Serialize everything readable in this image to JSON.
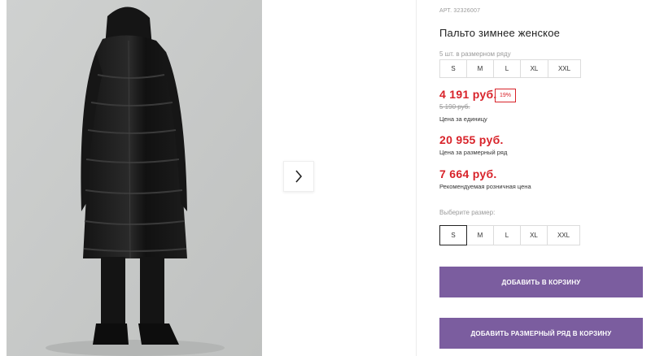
{
  "gallery": {
    "next_icon": "chevron-right-icon"
  },
  "product": {
    "sku": "АРТ. 32326007",
    "title": "Пальто зимнее женское",
    "row_note": "5 шт. в размерном ряду",
    "row_sizes": [
      "S",
      "M",
      "L",
      "XL",
      "XXL"
    ],
    "price": "4 191 руб.",
    "discount": "19%",
    "old_price": "5 190 руб.",
    "price_unit_label": "Цена за единицу",
    "row_price": "20 955 руб.",
    "row_price_label": "Цена за размерный ряд",
    "rrp": "7 664 руб.",
    "rrp_label": "Рекомендуемая розничная цена",
    "choose_size_label": "Выберите размер:",
    "size_options": [
      "S",
      "M",
      "L",
      "XL",
      "XXL"
    ],
    "selected_size": "S",
    "add_to_cart": "ДОБАВИТЬ В КОРЗИНУ",
    "add_row_to_cart": "ДОБАВИТЬ РАЗМЕРНЫЙ РЯД В КОРЗИНУ"
  },
  "colors": {
    "price_red": "#d8232a",
    "button_purple": "#7b5d9f"
  }
}
